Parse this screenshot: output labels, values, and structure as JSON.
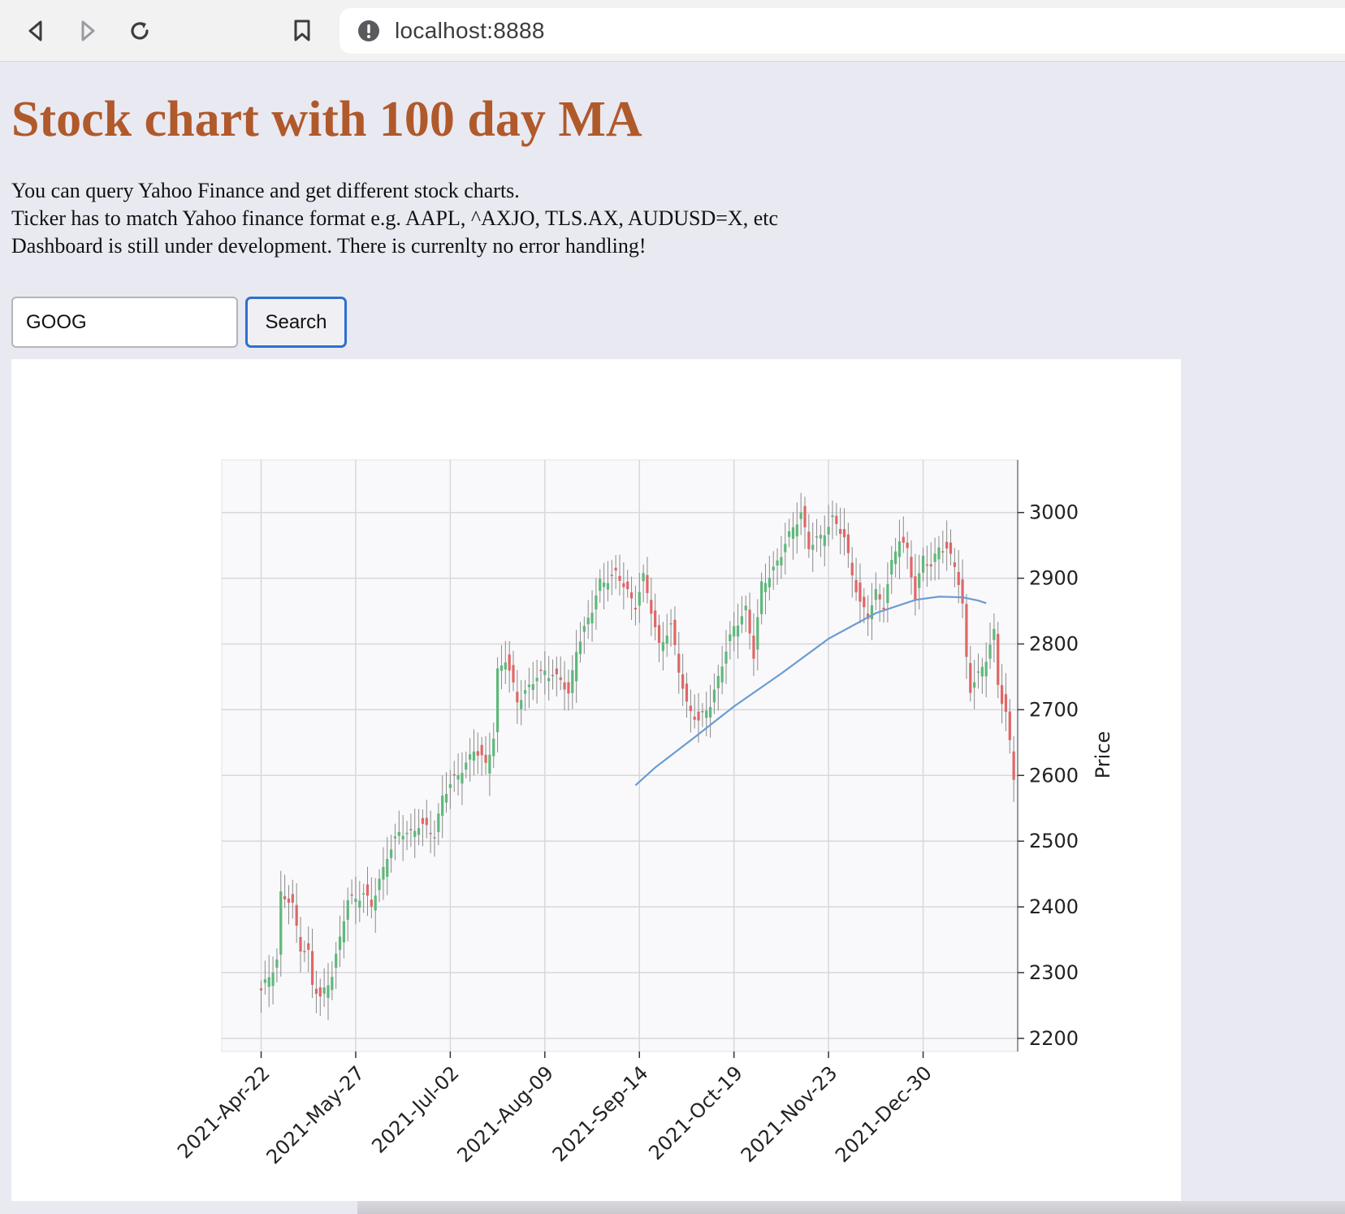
{
  "browser": {
    "url": "localhost:8888",
    "icons": [
      "back-icon",
      "forward-icon",
      "reload-icon",
      "bookmark-icon",
      "info-icon"
    ]
  },
  "page": {
    "title": "Stock chart with 100 day MA",
    "description": [
      "You can query Yahoo Finance and get different stock charts.",
      "Ticker has to match Yahoo finance format e.g. AAPL, ^AXJO, TLS.AX, AUDUSD=X, etc",
      "Dashboard is still under development. There is currenlty no error handling!"
    ],
    "ticker_value": "GOOG",
    "search_label": "Search"
  },
  "colors": {
    "title": "#b0592a",
    "up_candle": "#5fb87a",
    "down_candle": "#e06666",
    "ma_line": "#6b9bd1",
    "search_border": "#2f6fd0"
  },
  "chart_data": {
    "type": "candlestick",
    "ylabel": "Price",
    "ylim": [
      2180,
      3080
    ],
    "yticks": [
      2200,
      2300,
      2400,
      2500,
      2600,
      2700,
      2800,
      2900,
      3000
    ],
    "x_tick_labels": [
      "2021-Apr-22",
      "2021-May-27",
      "2021-Jul-02",
      "2021-Aug-09",
      "2021-Sep-14",
      "2021-Oct-19",
      "2021-Nov-23",
      "2021-Dec-30"
    ],
    "x_tick_positions": [
      0,
      24,
      48,
      72,
      96,
      120,
      144,
      168
    ],
    "x_range": [
      -10,
      192
    ],
    "grid": true,
    "close_points": [
      [
        0,
        2270
      ],
      [
        4,
        2320
      ],
      [
        5,
        2420
      ],
      [
        8,
        2400
      ],
      [
        10,
        2340
      ],
      [
        12,
        2330
      ],
      [
        13,
        2280
      ],
      [
        15,
        2260
      ],
      [
        18,
        2300
      ],
      [
        20,
        2350
      ],
      [
        22,
        2410
      ],
      [
        26,
        2420
      ],
      [
        28,
        2400
      ],
      [
        32,
        2480
      ],
      [
        35,
        2510
      ],
      [
        38,
        2515
      ],
      [
        40,
        2525
      ],
      [
        44,
        2510
      ],
      [
        46,
        2570
      ],
      [
        50,
        2600
      ],
      [
        54,
        2640
      ],
      [
        57,
        2615
      ],
      [
        59,
        2660
      ],
      [
        60,
        2760
      ],
      [
        62,
        2775
      ],
      [
        65,
        2715
      ],
      [
        68,
        2735
      ],
      [
        72,
        2760
      ],
      [
        76,
        2745
      ],
      [
        78,
        2720
      ],
      [
        80,
        2795
      ],
      [
        84,
        2850
      ],
      [
        86,
        2895
      ],
      [
        90,
        2905
      ],
      [
        93,
        2880
      ],
      [
        95,
        2860
      ],
      [
        97,
        2900
      ],
      [
        99,
        2850
      ],
      [
        101,
        2800
      ],
      [
        104,
        2825
      ],
      [
        106,
        2760
      ],
      [
        108,
        2710
      ],
      [
        111,
        2680
      ],
      [
        114,
        2710
      ],
      [
        117,
        2770
      ],
      [
        120,
        2825
      ],
      [
        123,
        2855
      ],
      [
        125,
        2780
      ],
      [
        127,
        2890
      ],
      [
        130,
        2915
      ],
      [
        132,
        2935
      ],
      [
        135,
        2980
      ],
      [
        137,
        3000
      ],
      [
        139,
        2945
      ],
      [
        142,
        2965
      ],
      [
        145,
        2990
      ],
      [
        148,
        2960
      ],
      [
        150,
        2910
      ],
      [
        152,
        2860
      ],
      [
        154,
        2840
      ],
      [
        156,
        2880
      ],
      [
        158,
        2860
      ],
      [
        160,
        2920
      ],
      [
        162,
        2960
      ],
      [
        164,
        2945
      ],
      [
        166,
        2870
      ],
      [
        168,
        2930
      ],
      [
        170,
        2920
      ],
      [
        172,
        2950
      ],
      [
        174,
        2940
      ],
      [
        176,
        2920
      ],
      [
        177,
        2895
      ],
      [
        178,
        2860
      ],
      [
        179,
        2780
      ],
      [
        180,
        2730
      ],
      [
        182,
        2750
      ],
      [
        184,
        2780
      ],
      [
        186,
        2820
      ],
      [
        187,
        2740
      ],
      [
        188,
        2710
      ],
      [
        189,
        2690
      ],
      [
        190,
        2650
      ],
      [
        190.5,
        2625
      ],
      [
        191,
        2600
      ]
    ],
    "ma_points": [
      [
        95,
        2585
      ],
      [
        100,
        2612
      ],
      [
        110,
        2658
      ],
      [
        120,
        2705
      ],
      [
        132,
        2755
      ],
      [
        144,
        2808
      ],
      [
        156,
        2847
      ],
      [
        166,
        2867
      ],
      [
        172,
        2872
      ],
      [
        178,
        2871
      ],
      [
        182,
        2866
      ],
      [
        184,
        2862
      ]
    ]
  }
}
